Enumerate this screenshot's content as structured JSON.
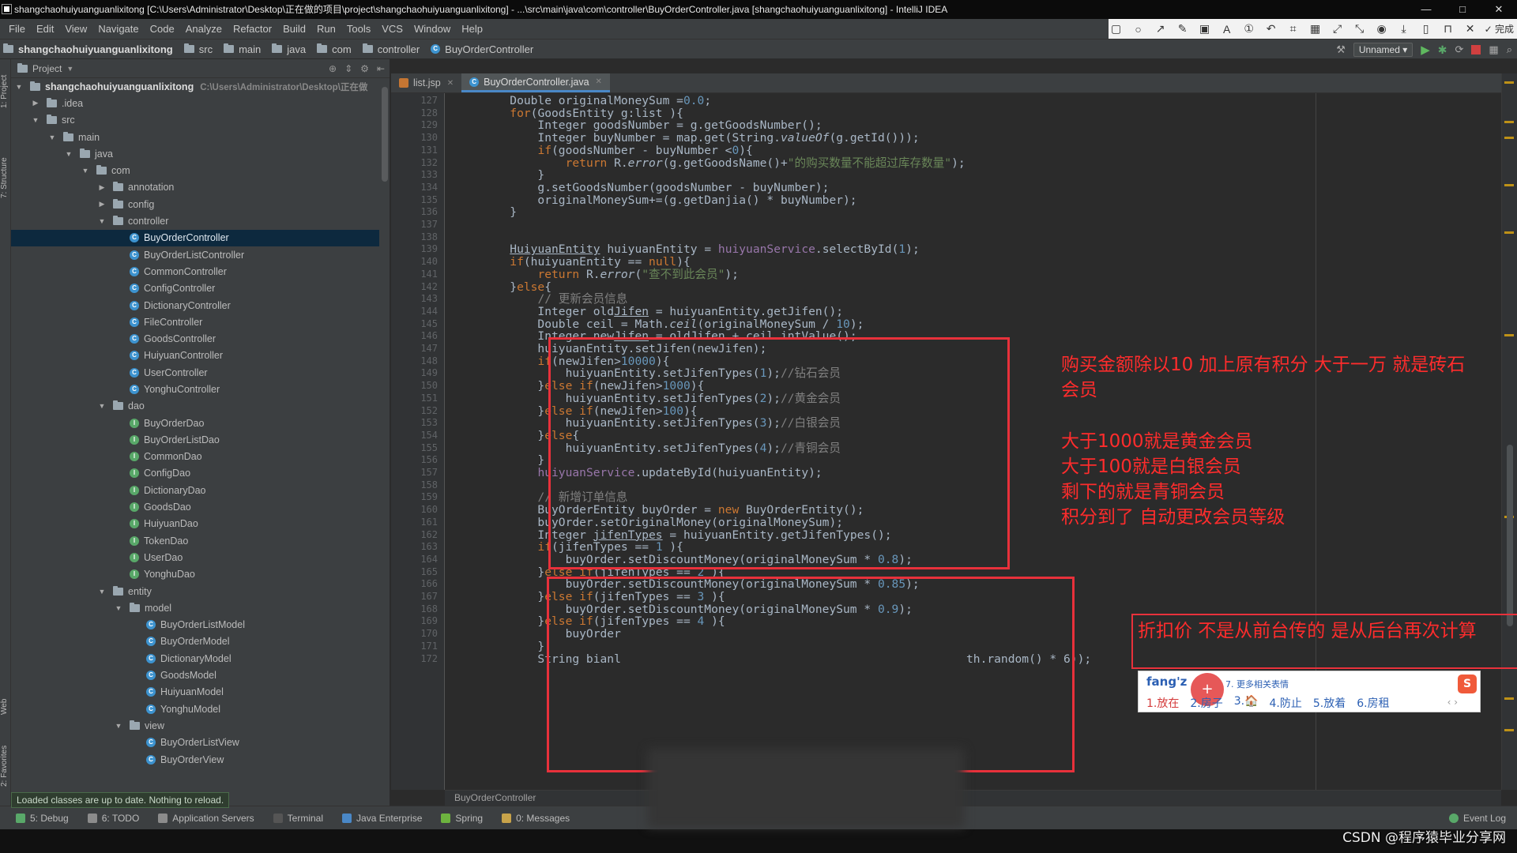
{
  "window": {
    "title": "shangchaohuiyuanguanlixitong [C:\\Users\\Administrator\\Desktop\\正在做的项目\\project\\shangchaohuiyuanguanlixitong] - ...\\src\\main\\java\\com\\controller\\BuyOrderController.java [shangchaohuiyuanguanlixitong] - IntelliJ IDEA",
    "controls": [
      "—",
      "□",
      "✕"
    ]
  },
  "menu": [
    "File",
    "Edit",
    "View",
    "Navigate",
    "Code",
    "Analyze",
    "Refactor",
    "Build",
    "Run",
    "Tools",
    "VCS",
    "Window",
    "Help"
  ],
  "annotation_toolbar": {
    "icons": [
      "▢",
      "○",
      "↗",
      "✎",
      "▣",
      "A",
      "①",
      "↶",
      "⌗",
      "▦",
      "⤢",
      "⤡",
      "◉",
      "⤓",
      "▯",
      "⊓",
      "✕"
    ],
    "done_label": "✓ 完成"
  },
  "navbar": {
    "crumbs": [
      "shangchaohuiyuanguanlixitong",
      "src",
      "main",
      "java",
      "com",
      "controller",
      "BuyOrderController"
    ],
    "run_config": "Unnamed ▾"
  },
  "project_panel": {
    "title": "Project",
    "root_path": "C:\\Users\\Administrator\\Desktop\\正在做",
    "tree": [
      {
        "label": "shangchaohuiyuanguanlixitong",
        "depth": 0,
        "kind": "root",
        "expanded": true
      },
      {
        "label": ".idea",
        "depth": 1,
        "kind": "folder",
        "expanded": false
      },
      {
        "label": "src",
        "depth": 1,
        "kind": "folder",
        "expanded": true
      },
      {
        "label": "main",
        "depth": 2,
        "kind": "folder",
        "expanded": true
      },
      {
        "label": "java",
        "depth": 3,
        "kind": "folder",
        "expanded": true
      },
      {
        "label": "com",
        "depth": 4,
        "kind": "folder",
        "expanded": true
      },
      {
        "label": "annotation",
        "depth": 5,
        "kind": "folder",
        "expanded": false
      },
      {
        "label": "config",
        "depth": 5,
        "kind": "folder",
        "expanded": false
      },
      {
        "label": "controller",
        "depth": 5,
        "kind": "folder",
        "expanded": true
      },
      {
        "label": "BuyOrderController",
        "depth": 6,
        "kind": "class",
        "selected": true
      },
      {
        "label": "BuyOrderListController",
        "depth": 6,
        "kind": "class"
      },
      {
        "label": "CommonController",
        "depth": 6,
        "kind": "class"
      },
      {
        "label": "ConfigController",
        "depth": 6,
        "kind": "class"
      },
      {
        "label": "DictionaryController",
        "depth": 6,
        "kind": "class"
      },
      {
        "label": "FileController",
        "depth": 6,
        "kind": "class"
      },
      {
        "label": "GoodsController",
        "depth": 6,
        "kind": "class"
      },
      {
        "label": "HuiyuanController",
        "depth": 6,
        "kind": "class"
      },
      {
        "label": "UserController",
        "depth": 6,
        "kind": "class"
      },
      {
        "label": "YonghuController",
        "depth": 6,
        "kind": "class"
      },
      {
        "label": "dao",
        "depth": 5,
        "kind": "folder",
        "expanded": true
      },
      {
        "label": "BuyOrderDao",
        "depth": 6,
        "kind": "interface"
      },
      {
        "label": "BuyOrderListDao",
        "depth": 6,
        "kind": "interface"
      },
      {
        "label": "CommonDao",
        "depth": 6,
        "kind": "interface"
      },
      {
        "label": "ConfigDao",
        "depth": 6,
        "kind": "interface"
      },
      {
        "label": "DictionaryDao",
        "depth": 6,
        "kind": "interface"
      },
      {
        "label": "GoodsDao",
        "depth": 6,
        "kind": "interface"
      },
      {
        "label": "HuiyuanDao",
        "depth": 6,
        "kind": "interface"
      },
      {
        "label": "TokenDao",
        "depth": 6,
        "kind": "interface"
      },
      {
        "label": "UserDao",
        "depth": 6,
        "kind": "interface"
      },
      {
        "label": "YonghuDao",
        "depth": 6,
        "kind": "interface"
      },
      {
        "label": "entity",
        "depth": 5,
        "kind": "folder",
        "expanded": true
      },
      {
        "label": "model",
        "depth": 6,
        "kind": "folder",
        "expanded": true
      },
      {
        "label": "BuyOrderListModel",
        "depth": 7,
        "kind": "class"
      },
      {
        "label": "BuyOrderModel",
        "depth": 7,
        "kind": "class"
      },
      {
        "label": "DictionaryModel",
        "depth": 7,
        "kind": "class"
      },
      {
        "label": "GoodsModel",
        "depth": 7,
        "kind": "class"
      },
      {
        "label": "HuiyuanModel",
        "depth": 7,
        "kind": "class"
      },
      {
        "label": "YonghuModel",
        "depth": 7,
        "kind": "class"
      },
      {
        "label": "view",
        "depth": 6,
        "kind": "folder",
        "expanded": true
      },
      {
        "label": "BuyOrderListView",
        "depth": 7,
        "kind": "class"
      },
      {
        "label": "BuyOrderView",
        "depth": 7,
        "kind": "class"
      }
    ],
    "status_tip": "Loaded classes are up to date. Nothing to reload."
  },
  "left_strip_tabs": [
    "1: Project",
    "7: Structure",
    "2: Favorites",
    "Web"
  ],
  "editor": {
    "tabs": [
      {
        "label": "list.jsp",
        "active": false,
        "icon": "jsp"
      },
      {
        "label": "BuyOrderController.java",
        "active": true,
        "icon": "class"
      }
    ],
    "lines": [
      {
        "n": 127,
        "t": [
          [
            "        Double originalMoneySum =",
            "p"
          ],
          [
            "0.0",
            "num"
          ],
          [
            ";",
            "p"
          ]
        ]
      },
      {
        "n": 128,
        "t": [
          [
            "        ",
            "p"
          ],
          [
            "for",
            "kw"
          ],
          [
            "(GoodsEntity g:list ){",
            "p"
          ]
        ]
      },
      {
        "n": 129,
        "t": [
          [
            "            Integer goodsNumber = g.getGoodsNumber();",
            "p"
          ]
        ]
      },
      {
        "n": 130,
        "t": [
          [
            "            Integer buyNumber = map.get(String.",
            "p"
          ],
          [
            "valueOf",
            "it"
          ],
          [
            "(g.getId()));",
            "p"
          ]
        ]
      },
      {
        "n": 131,
        "t": [
          [
            "            ",
            "p"
          ],
          [
            "if",
            "kw"
          ],
          [
            "(goodsNumber - buyNumber <",
            "p"
          ],
          [
            "0",
            "num"
          ],
          [
            "){",
            "p"
          ]
        ]
      },
      {
        "n": 132,
        "t": [
          [
            "                ",
            "p"
          ],
          [
            "return",
            "kw"
          ],
          [
            " R.",
            "p"
          ],
          [
            "error",
            "it"
          ],
          [
            "(g.getGoodsName()+",
            "p"
          ],
          [
            "\"的购买数量不能超过库存数量\"",
            "str"
          ],
          [
            ");",
            "p"
          ]
        ]
      },
      {
        "n": 133,
        "t": [
          [
            "            }",
            "p"
          ]
        ]
      },
      {
        "n": 134,
        "t": [
          [
            "            g.setGoodsNumber(goodsNumber - buyNumber);",
            "p"
          ]
        ]
      },
      {
        "n": 135,
        "t": [
          [
            "            originalMoneySum+=(g.getDanjia() * buyNumber);",
            "p"
          ]
        ]
      },
      {
        "n": 136,
        "t": [
          [
            "        }",
            "p"
          ]
        ]
      },
      {
        "n": 137,
        "t": []
      },
      {
        "n": 138,
        "t": []
      },
      {
        "n": 139,
        "t": [
          [
            "        ",
            "p"
          ],
          [
            "HuiyuanEntity",
            "ul"
          ],
          [
            " huiyuanEntity = ",
            "p"
          ],
          [
            "huiyuanService",
            "fld"
          ],
          [
            ".selectById(",
            "p"
          ],
          [
            "1",
            "num"
          ],
          [
            ");",
            "p"
          ]
        ]
      },
      {
        "n": 140,
        "t": [
          [
            "        ",
            "p"
          ],
          [
            "if",
            "kw"
          ],
          [
            "(huiyuanEntity == ",
            "p"
          ],
          [
            "null",
            "kw"
          ],
          [
            "){",
            "p"
          ]
        ]
      },
      {
        "n": 141,
        "t": [
          [
            "            ",
            "p"
          ],
          [
            "return",
            "kw"
          ],
          [
            " R.",
            "p"
          ],
          [
            "error",
            "it"
          ],
          [
            "(",
            "p"
          ],
          [
            "\"查不到此会员\"",
            "str"
          ],
          [
            ");",
            "p"
          ]
        ]
      },
      {
        "n": 142,
        "t": [
          [
            "        }",
            "p"
          ],
          [
            "else",
            "kw"
          ],
          [
            "{",
            "p"
          ]
        ]
      },
      {
        "n": 143,
        "t": [
          [
            "            ",
            "p"
          ],
          [
            "// 更新会员信息",
            "cmt"
          ]
        ]
      },
      {
        "n": 144,
        "t": [
          [
            "            Integer old",
            "p"
          ],
          [
            "Jifen",
            "ul"
          ],
          [
            " = huiyuanEntity.getJifen();",
            "p"
          ]
        ]
      },
      {
        "n": 145,
        "t": [
          [
            "            Double ceil = Math.",
            "p"
          ],
          [
            "ceil",
            "it"
          ],
          [
            "(originalMoneySum / ",
            "p"
          ],
          [
            "10",
            "num"
          ],
          [
            ");",
            "p"
          ]
        ]
      },
      {
        "n": 146,
        "t": [
          [
            "            Integer new",
            "p"
          ],
          [
            "Jifen",
            "ul"
          ],
          [
            " = oldJifen + ceil.intValue();",
            "p"
          ]
        ]
      },
      {
        "n": 147,
        "t": [
          [
            "            huiyuanEntity.setJifen(newJifen);",
            "p"
          ]
        ]
      },
      {
        "n": 148,
        "t": [
          [
            "            ",
            "p"
          ],
          [
            "if",
            "kw"
          ],
          [
            "(newJifen>",
            "p"
          ],
          [
            "10000",
            "num"
          ],
          [
            "){",
            "p"
          ]
        ]
      },
      {
        "n": 149,
        "t": [
          [
            "                huiyuanEntity.setJifenTypes(",
            "p"
          ],
          [
            "1",
            "num"
          ],
          [
            ");",
            "p"
          ],
          [
            "//钻石会员",
            "cmt"
          ]
        ]
      },
      {
        "n": 150,
        "t": [
          [
            "            }",
            "p"
          ],
          [
            "else if",
            "kw"
          ],
          [
            "(newJifen>",
            "p"
          ],
          [
            "1000",
            "num"
          ],
          [
            "){",
            "p"
          ]
        ]
      },
      {
        "n": 151,
        "t": [
          [
            "                huiyuanEntity.setJifenTypes(",
            "p"
          ],
          [
            "2",
            "num"
          ],
          [
            ");",
            "p"
          ],
          [
            "//黄金会员",
            "cmt"
          ]
        ]
      },
      {
        "n": 152,
        "t": [
          [
            "            }",
            "p"
          ],
          [
            "else if",
            "kw"
          ],
          [
            "(newJifen>",
            "p"
          ],
          [
            "100",
            "num"
          ],
          [
            "){",
            "p"
          ]
        ]
      },
      {
        "n": 153,
        "t": [
          [
            "                huiyuanEntity.setJifenTypes(",
            "p"
          ],
          [
            "3",
            "num"
          ],
          [
            ");",
            "p"
          ],
          [
            "//白银会员",
            "cmt"
          ]
        ]
      },
      {
        "n": 154,
        "t": [
          [
            "            }",
            "p"
          ],
          [
            "else",
            "kw"
          ],
          [
            "{",
            "p"
          ]
        ]
      },
      {
        "n": 155,
        "t": [
          [
            "                huiyuanEntity.setJifenTypes(",
            "p"
          ],
          [
            "4",
            "num"
          ],
          [
            ");",
            "p"
          ],
          [
            "//青铜会员",
            "cmt"
          ]
        ]
      },
      {
        "n": 156,
        "t": [
          [
            "            }",
            "p"
          ]
        ]
      },
      {
        "n": 157,
        "t": [
          [
            "            ",
            "p"
          ],
          [
            "huiyuanService",
            "fld"
          ],
          [
            ".updateById(huiyuanEntity);",
            "p"
          ]
        ]
      },
      {
        "n": 158,
        "t": []
      },
      {
        "n": 159,
        "t": [
          [
            "            ",
            "p"
          ],
          [
            "// 新增订单信息",
            "cmt"
          ]
        ]
      },
      {
        "n": 160,
        "t": [
          [
            "            BuyOrderEntity buyOrder = ",
            "p"
          ],
          [
            "new",
            "kw"
          ],
          [
            " BuyOrderEntity();",
            "p"
          ]
        ]
      },
      {
        "n": 161,
        "t": [
          [
            "            buyOrder.setOriginalMoney(originalMoneySum);",
            "p"
          ]
        ]
      },
      {
        "n": 162,
        "t": [
          [
            "            Integer ",
            "p"
          ],
          [
            "jifenTypes",
            "ul"
          ],
          [
            " = huiyuanEntity.getJifenTypes();",
            "p"
          ]
        ]
      },
      {
        "n": 163,
        "t": [
          [
            "            ",
            "p"
          ],
          [
            "if",
            "kw"
          ],
          [
            "(jifenTypes == ",
            "p"
          ],
          [
            "1",
            "num"
          ],
          [
            " ){",
            "p"
          ]
        ]
      },
      {
        "n": 164,
        "t": [
          [
            "                buyOrder.setDiscountMoney(originalMoneySum * ",
            "p"
          ],
          [
            "0.8",
            "num"
          ],
          [
            ");",
            "p"
          ]
        ]
      },
      {
        "n": 165,
        "t": [
          [
            "            }",
            "p"
          ],
          [
            "else if",
            "kw"
          ],
          [
            "(jifenTypes == ",
            "p"
          ],
          [
            "2",
            "num"
          ],
          [
            " ){",
            "p"
          ]
        ]
      },
      {
        "n": 166,
        "t": [
          [
            "                buyOrder.setDiscountMoney(originalMoneySum * ",
            "p"
          ],
          [
            "0.85",
            "num"
          ],
          [
            ");",
            "p"
          ]
        ]
      },
      {
        "n": 167,
        "t": [
          [
            "            }",
            "p"
          ],
          [
            "else if",
            "kw"
          ],
          [
            "(jifenTypes == ",
            "p"
          ],
          [
            "3",
            "num"
          ],
          [
            " ){",
            "p"
          ]
        ]
      },
      {
        "n": 168,
        "t": [
          [
            "                buyOrder.setDiscountMoney(originalMoneySum * ",
            "p"
          ],
          [
            "0.9",
            "num"
          ],
          [
            ");",
            "p"
          ]
        ]
      },
      {
        "n": 169,
        "t": [
          [
            "            }",
            "p"
          ],
          [
            "else if",
            "kw"
          ],
          [
            "(jifenTypes == ",
            "p"
          ],
          [
            "4",
            "num"
          ],
          [
            " ){",
            "p"
          ]
        ]
      },
      {
        "n": 170,
        "t": [
          [
            "                buyOrder",
            "p"
          ]
        ]
      },
      {
        "n": 171,
        "t": [
          [
            "            }",
            "p"
          ]
        ]
      },
      {
        "n": 172,
        "t": [
          [
            "            String bianl",
            "p"
          ]
        ]
      }
    ],
    "line_172_tail": "th.random() * 6));",
    "breadcrumb": "BuyOrderController"
  },
  "annotations": {
    "note_1": [
      "购买金额除以10  加上原有积分  大于一万 就是砖石",
      "会员"
    ],
    "note_2": [
      "大于1000就是黄金会员",
      "大于100就是白银会员",
      "剩下的就是青铜会员",
      "积分到了 自动更改会员等级"
    ],
    "note_3": "折扣价 不是从前台传的 是从后台再次计算"
  },
  "ime": {
    "input": "fang'z",
    "more": "7. 更多相关表情",
    "candidates": [
      "1.放在",
      "2.房子",
      "3.🏠",
      "4.防止",
      "5.放着",
      "6.房租"
    ],
    "nav": "‹  ›",
    "logo": "S"
  },
  "bottom_tools": [
    {
      "label": "5: Debug",
      "color": "#59a869"
    },
    {
      "label": "6: TODO",
      "color": "#8c8c8c"
    },
    {
      "label": "Application Servers",
      "color": "#8c8c8c"
    },
    {
      "label": "Terminal",
      "color": "#555555"
    },
    {
      "label": "Java Enterprise",
      "color": "#4a88c7"
    },
    {
      "label": "Spring",
      "color": "#6db33f"
    },
    {
      "label": "0: Messages",
      "color": "#c8a34a"
    }
  ],
  "event_log": "Event Log",
  "watermark": "CSDN @程序猿毕业分享网"
}
